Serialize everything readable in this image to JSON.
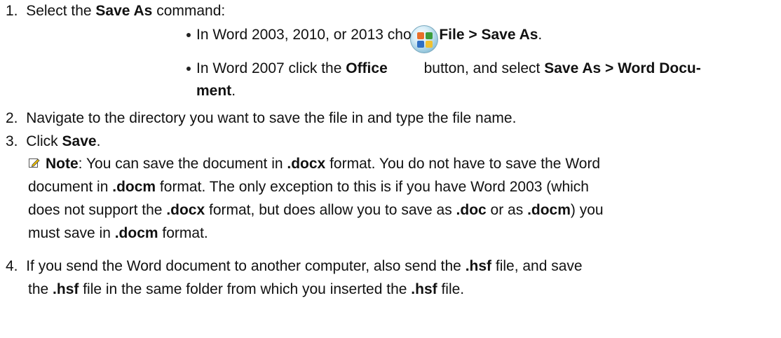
{
  "steps": [
    {
      "num": "1.",
      "parts": [
        "Select the ",
        "Save As",
        " command:"
      ]
    },
    {
      "num": "2.",
      "text": "Navigate to the directory you want to save the file in and type the file name."
    },
    {
      "num": "3.",
      "parts": [
        "Click ",
        "Save",
        "."
      ]
    },
    {
      "num": "4.",
      "lines": [
        [
          "If you send the Word document to another computer, also send the ",
          ".hsf",
          " file, and save"
        ],
        [
          "the ",
          ".hsf",
          " file in the same folder from which you inserted the ",
          ".hsf",
          " file."
        ]
      ]
    }
  ],
  "bullets": [
    {
      "parts": [
        "In Word 2003, 2010, or 2013 choose ",
        "File > Save As",
        "."
      ]
    },
    {
      "parts": [
        "In Word 2007 click the ",
        "Office",
        " button, and select ",
        "Save As > Word Docu-"
      ],
      "continuation": "ment",
      "continuation_tail": "."
    }
  ],
  "note": {
    "icon": "note-pencil-icon",
    "lines": [
      [
        "Note",
        ": You can save the document in ",
        ".docx",
        " format. You do not have to save the Word"
      ],
      [
        "document in ",
        ".docm",
        " format. The only exception to this is if you have Word 2003 (which"
      ],
      [
        "does not support the ",
        ".docx",
        " format, but does allow you to save as ",
        ".doc",
        " or as ",
        ".docm",
        ") you"
      ],
      [
        "must save in ",
        ".docm",
        " format."
      ]
    ]
  },
  "office_icon": "office-button-icon"
}
